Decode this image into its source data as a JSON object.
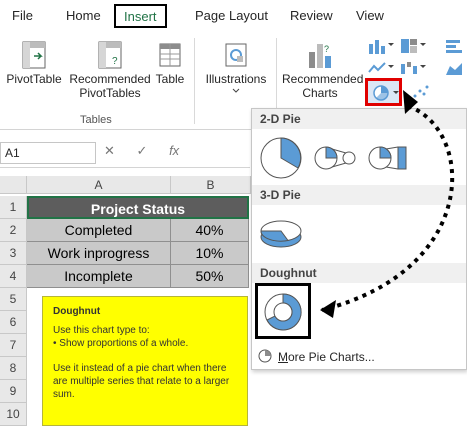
{
  "tabs": [
    "File",
    "Home",
    "Insert",
    "Page Layout",
    "Review",
    "View"
  ],
  "ribbon": {
    "pivottable": "PivotTable",
    "recommended_pivot_line1": "Recommended",
    "recommended_pivot_line2": "PivotTables",
    "table": "Table",
    "tables_group": "Tables",
    "illustrations": "Illustrations",
    "recommended_charts_line1": "Recommended",
    "recommended_charts_line2": "Charts"
  },
  "formula_bar": {
    "name_box": "A1",
    "cancel": "✕",
    "enter": "✓",
    "fx": "fx"
  },
  "columns": [
    "A",
    "B"
  ],
  "rows": [
    "1",
    "2",
    "3",
    "4",
    "5",
    "6",
    "7",
    "8",
    "9",
    "10"
  ],
  "table": {
    "header": "Project Status",
    "rows": [
      {
        "status": "Completed",
        "pct": "40%"
      },
      {
        "status": "Work inprogress",
        "pct": "10%"
      },
      {
        "status": "Incomplete",
        "pct": "50%"
      }
    ]
  },
  "tooltip": {
    "title": "Doughnut",
    "line1": "Use this chart type to:",
    "line2": "• Show proportions of a whole.",
    "line3": "Use it instead of a pie chart when there are multiple series that relate to a larger sum."
  },
  "panel": {
    "pie2d": "2-D Pie",
    "pie3d": "3-D Pie",
    "doughnut": "Doughnut",
    "more_prefix": "M",
    "more_rest": "ore Pie Charts..."
  },
  "colors": {
    "accent": "#5b9bd5",
    "highlight_red": "#e00000",
    "tooltip_bg": "#ffff00",
    "excel_green": "#217346"
  }
}
